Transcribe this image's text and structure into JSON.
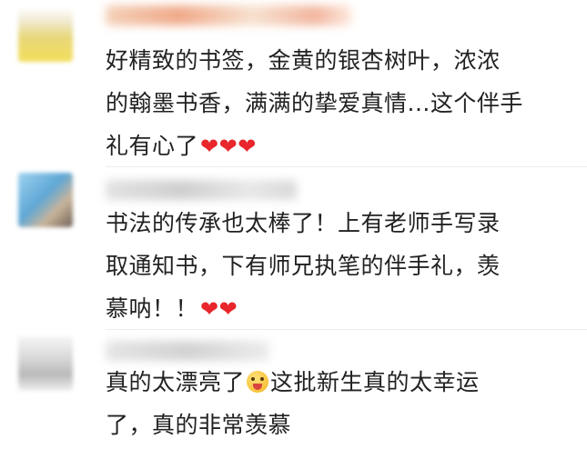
{
  "comments": [
    {
      "lines": [
        "好精致的书签，金黄的银杏树叶，浓浓",
        "的翰墨书香，满满的挚爱真情...这个伴手",
        "礼有心了"
      ],
      "hearts": "❤❤❤"
    },
    {
      "lines": [
        "书法的传承也太棒了！上有老师手写录",
        "取通知书，下有师兄执笔的伴手礼，羡",
        "慕呐！！"
      ],
      "hearts": "❤❤"
    },
    {
      "line1_before": "真的太漂亮了",
      "line1_after": "这批新生真的太幸运",
      "line2": "了，真的非常羡慕"
    }
  ],
  "icons": {
    "heart": "heart-emoji",
    "face": "tongue-out-emoji"
  },
  "colors": {
    "heart": "#e8262b",
    "text": "#222222"
  }
}
